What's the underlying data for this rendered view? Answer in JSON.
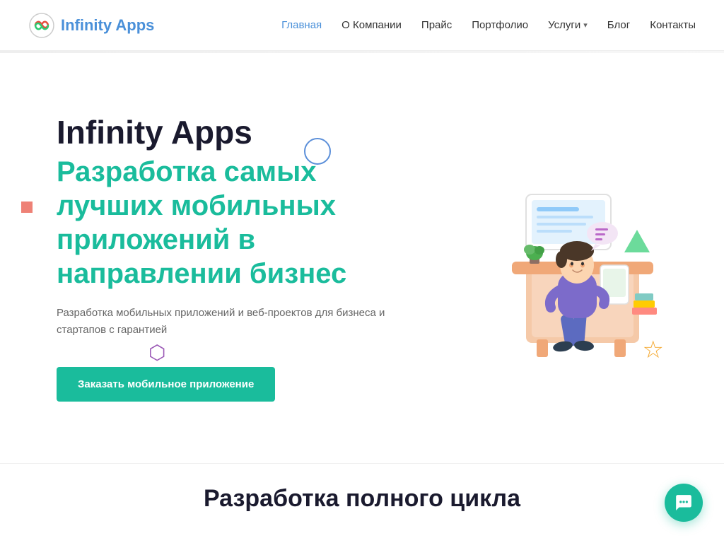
{
  "header": {
    "logo_text": "Infinity Apps",
    "nav": {
      "items": [
        {
          "label": "Главная",
          "active": true
        },
        {
          "label": "О Компании",
          "active": false
        },
        {
          "label": "Прайс",
          "active": false
        },
        {
          "label": "Портфолио",
          "active": false
        },
        {
          "label": "Услуги",
          "active": false,
          "has_dropdown": true
        },
        {
          "label": "Блог",
          "active": false
        },
        {
          "label": "Контакты",
          "active": false
        }
      ]
    }
  },
  "hero": {
    "title_black": "Infinity Apps",
    "title_teal": "Разработка самых лучших мобильных приложений в направлении бизнес",
    "subtitle": "Разработка мобильных приложений и веб-проектов для бизнеса и стартапов с гарантией",
    "cta_label": "Заказать мобильное приложение"
  },
  "bottom_section": {
    "title": "Разработка полного цикла"
  },
  "chat_button": {
    "label": "💬"
  },
  "colors": {
    "teal": "#1abc9c",
    "blue": "#4a90d9",
    "dark": "#1a1a2e"
  }
}
